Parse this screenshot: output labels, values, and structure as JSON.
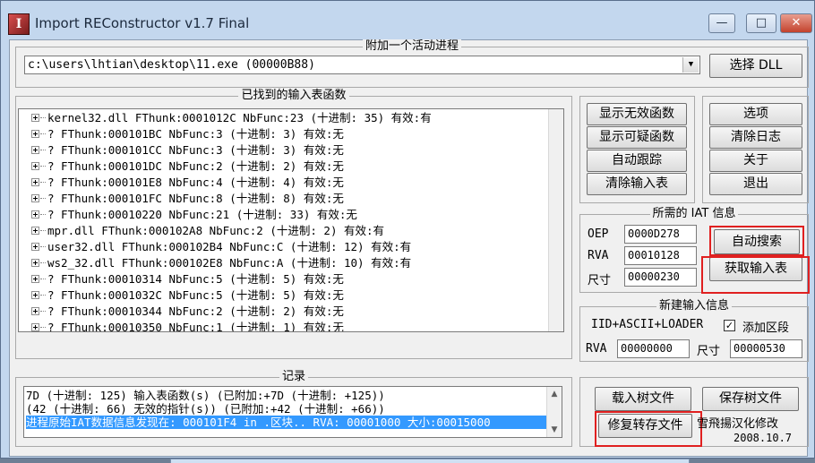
{
  "window": {
    "title": "Import REConstructor v1.7 Final",
    "icon_letter": "I",
    "minimize_glyph": "—",
    "maximize_glyph": "□",
    "close_glyph": "✕"
  },
  "attach": {
    "group_label": "附加一个活动进程",
    "process_value": "c:\\users\\lhtian\\desktop\\11.exe (00000B88)",
    "combo_arrow": "▼",
    "select_dll_label": "选择 DLL"
  },
  "imports": {
    "group_label": "已找到的输入表函数",
    "rows": [
      "kernel32.dll FThunk:0001012C NbFunc:23 (十进制: 35) 有效:有",
      "? FThunk:000101BC NbFunc:3 (十进制: 3) 有效:无",
      "? FThunk:000101CC NbFunc:3 (十进制: 3) 有效:无",
      "? FThunk:000101DC NbFunc:2 (十进制: 2) 有效:无",
      "? FThunk:000101E8 NbFunc:4 (十进制: 4) 有效:无",
      "? FThunk:000101FC NbFunc:8 (十进制: 8) 有效:无",
      "? FThunk:00010220 NbFunc:21 (十进制: 33) 有效:无",
      "mpr.dll FThunk:000102A8 NbFunc:2 (十进制: 2) 有效:有",
      "user32.dll FThunk:000102B4 NbFunc:C (十进制: 12) 有效:有",
      "ws2_32.dll FThunk:000102E8 NbFunc:A (十进制: 10) 有效:有",
      "? FThunk:00010314 NbFunc:5 (十进制: 5) 有效:无",
      "? FThunk:0001032C NbFunc:5 (十进制: 5) 有效:无",
      "? FThunk:00010344 NbFunc:2 (十进制: 2) 有效:无",
      "? FThunk:00010350 NbFunc:1 (十进制: 1) 有效:无"
    ]
  },
  "buttons": {
    "show_invalid": "显示无效函数",
    "show_suspect": "显示可疑函数",
    "auto_trace": "自动跟踪",
    "clear_imports": "清除输入表",
    "options": "选项",
    "clear_log": "清除日志",
    "about": "关于",
    "exit": "退出"
  },
  "iat": {
    "group_label": "所需的 IAT 信息",
    "oep_label": "OEP",
    "oep_value": "0000D278",
    "rva_label": "RVA",
    "rva_value": "00010128",
    "size_label": "尺寸",
    "size_value": "00000230",
    "auto_search_label": "自动搜索",
    "get_imports_label": "获取输入表"
  },
  "new_import": {
    "group_label": "新建输入信息",
    "mode_label": "IID+ASCII+LOADER",
    "add_section_checked": "✓",
    "add_section_label": "添加区段",
    "rva_label": "RVA",
    "rva_value": "00000000",
    "size_label": "尺寸",
    "size_value": "00000530"
  },
  "log": {
    "group_label": "记录",
    "lines": [
      "7D (十进制: 125) 输入表函数(s) (已附加:+7D (十进制: +125))",
      "(42 (十进制: 66) 无效的指针(s)) (已附加:+42 (十进制: +66))",
      "进程原始IAT数据信息发现在: 000101F4 in .区块.. RVA: 00001000 大小:00015000"
    ]
  },
  "tree_files": {
    "load_tree": "载入树文件",
    "save_tree": "保存树文件",
    "fix_dump": "修复转存文件"
  },
  "credit": {
    "line1": "雪飛揚汉化修改",
    "line2": "2008.10.7"
  },
  "scroll": {
    "up": "▲",
    "down": "▼"
  }
}
